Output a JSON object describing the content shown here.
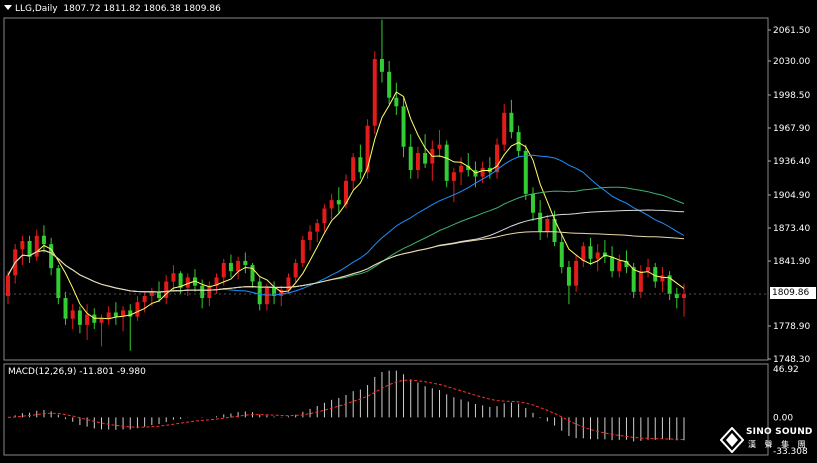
{
  "header": {
    "symbol": "LLG,Daily",
    "ohlc": "1807.72 1811.82 1806.38 1809.86"
  },
  "macd": {
    "label": "MACD(12,26,9) -11.801 -9.980",
    "axis_labels": [
      "46.92",
      "0.00",
      "-33.308"
    ]
  },
  "current_price": "1809.86",
  "logo": {
    "name": "SINO SOUND",
    "sub": "漢 聲 集 團",
    "icon": "diamond-logo-icon"
  },
  "colors": {
    "background": "#000000",
    "up_candle": "#e41b1b",
    "down_candle": "#33cc33",
    "ma_fast": "#ffff66",
    "ma_blue": "#1e90ff",
    "ma_green": "#3cb371",
    "ma_white": "#dddddd",
    "ma_tan": "#e8d8a8",
    "macd_signal": "#ff3030",
    "macd_hist": "#d0d0d0"
  },
  "chart_data": {
    "type": "candlestick",
    "y_ticks": [
      "2061.50",
      "2030.00",
      "1998.50",
      "1967.90",
      "1936.40",
      "1904.90",
      "1873.40",
      "1841.90",
      "1778.90",
      "1748.30"
    ],
    "ylim": [
      1748.3,
      2061.5
    ],
    "candles": [
      [
        1808,
        1832,
        1800,
        1828
      ],
      [
        1828,
        1858,
        1820,
        1853
      ],
      [
        1853,
        1866,
        1838,
        1861
      ],
      [
        1861,
        1866,
        1840,
        1846
      ],
      [
        1846,
        1872,
        1842,
        1866
      ],
      [
        1866,
        1876,
        1850,
        1858
      ],
      [
        1858,
        1864,
        1828,
        1835
      ],
      [
        1835,
        1838,
        1800,
        1806
      ],
      [
        1806,
        1812,
        1780,
        1786
      ],
      [
        1786,
        1800,
        1776,
        1794
      ],
      [
        1794,
        1798,
        1772,
        1780
      ],
      [
        1780,
        1800,
        1766,
        1790
      ],
      [
        1790,
        1796,
        1776,
        1782
      ],
      [
        1782,
        1790,
        1760,
        1786
      ],
      [
        1786,
        1798,
        1780,
        1792
      ],
      [
        1792,
        1802,
        1780,
        1788
      ],
      [
        1788,
        1798,
        1774,
        1794
      ],
      [
        1794,
        1800,
        1756,
        1788
      ],
      [
        1788,
        1808,
        1784,
        1802
      ],
      [
        1802,
        1812,
        1792,
        1808
      ],
      [
        1808,
        1816,
        1798,
        1812
      ],
      [
        1812,
        1822,
        1802,
        1806
      ],
      [
        1806,
        1828,
        1800,
        1822
      ],
      [
        1822,
        1838,
        1812,
        1830
      ],
      [
        1830,
        1832,
        1810,
        1816
      ],
      [
        1816,
        1830,
        1808,
        1826
      ],
      [
        1826,
        1834,
        1812,
        1818
      ],
      [
        1818,
        1824,
        1796,
        1806
      ],
      [
        1806,
        1822,
        1798,
        1818
      ],
      [
        1818,
        1830,
        1810,
        1826
      ],
      [
        1826,
        1844,
        1818,
        1840
      ],
      [
        1840,
        1848,
        1826,
        1832
      ],
      [
        1832,
        1846,
        1824,
        1842
      ],
      [
        1842,
        1850,
        1830,
        1838
      ],
      [
        1838,
        1840,
        1816,
        1822
      ],
      [
        1822,
        1826,
        1794,
        1800
      ],
      [
        1800,
        1820,
        1794,
        1816
      ],
      [
        1816,
        1822,
        1800,
        1808
      ],
      [
        1808,
        1818,
        1798,
        1814
      ],
      [
        1814,
        1830,
        1810,
        1826
      ],
      [
        1826,
        1844,
        1820,
        1840
      ],
      [
        1840,
        1866,
        1836,
        1862
      ],
      [
        1862,
        1876,
        1852,
        1870
      ],
      [
        1870,
        1882,
        1860,
        1878
      ],
      [
        1878,
        1896,
        1870,
        1892
      ],
      [
        1892,
        1906,
        1882,
        1900
      ],
      [
        1900,
        1912,
        1888,
        1896
      ],
      [
        1896,
        1924,
        1892,
        1918
      ],
      [
        1918,
        1944,
        1910,
        1940
      ],
      [
        1940,
        1952,
        1920,
        1926
      ],
      [
        1926,
        1976,
        1920,
        1970
      ],
      [
        1970,
        2040,
        1962,
        2032
      ],
      [
        2032,
        2072,
        2010,
        2020
      ],
      [
        2020,
        2030,
        1990,
        1996
      ],
      [
        1996,
        2010,
        1980,
        1988
      ],
      [
        1988,
        1996,
        1940,
        1950
      ],
      [
        1950,
        1962,
        1920,
        1928
      ],
      [
        1928,
        1950,
        1920,
        1944
      ],
      [
        1944,
        1962,
        1930,
        1934
      ],
      [
        1934,
        1956,
        1918,
        1948
      ],
      [
        1948,
        1966,
        1940,
        1952
      ],
      [
        1952,
        1956,
        1912,
        1918
      ],
      [
        1918,
        1930,
        1898,
        1926
      ],
      [
        1926,
        1940,
        1914,
        1932
      ],
      [
        1932,
        1944,
        1922,
        1928
      ],
      [
        1928,
        1936,
        1912,
        1922
      ],
      [
        1922,
        1936,
        1916,
        1930
      ],
      [
        1930,
        1940,
        1920,
        1926
      ],
      [
        1926,
        1958,
        1920,
        1952
      ],
      [
        1952,
        1990,
        1946,
        1982
      ],
      [
        1982,
        1994,
        1958,
        1964
      ],
      [
        1964,
        1970,
        1940,
        1946
      ],
      [
        1946,
        1952,
        1900,
        1906
      ],
      [
        1906,
        1912,
        1880,
        1888
      ],
      [
        1888,
        1900,
        1862,
        1870
      ],
      [
        1870,
        1886,
        1864,
        1882
      ],
      [
        1882,
        1890,
        1856,
        1860
      ],
      [
        1860,
        1868,
        1830,
        1836
      ],
      [
        1836,
        1842,
        1800,
        1818
      ],
      [
        1818,
        1848,
        1812,
        1842
      ],
      [
        1842,
        1860,
        1836,
        1856
      ],
      [
        1856,
        1864,
        1838,
        1844
      ],
      [
        1844,
        1858,
        1832,
        1850
      ],
      [
        1850,
        1862,
        1840,
        1846
      ],
      [
        1846,
        1856,
        1826,
        1832
      ],
      [
        1832,
        1848,
        1826,
        1842
      ],
      [
        1842,
        1852,
        1830,
        1836
      ],
      [
        1836,
        1840,
        1806,
        1812
      ],
      [
        1812,
        1838,
        1806,
        1832
      ],
      [
        1832,
        1844,
        1826,
        1836
      ],
      [
        1836,
        1840,
        1816,
        1822
      ],
      [
        1822,
        1836,
        1812,
        1828
      ],
      [
        1828,
        1832,
        1804,
        1810
      ],
      [
        1810,
        1816,
        1796,
        1806
      ],
      [
        1806,
        1820,
        1788,
        1810
      ]
    ]
  }
}
